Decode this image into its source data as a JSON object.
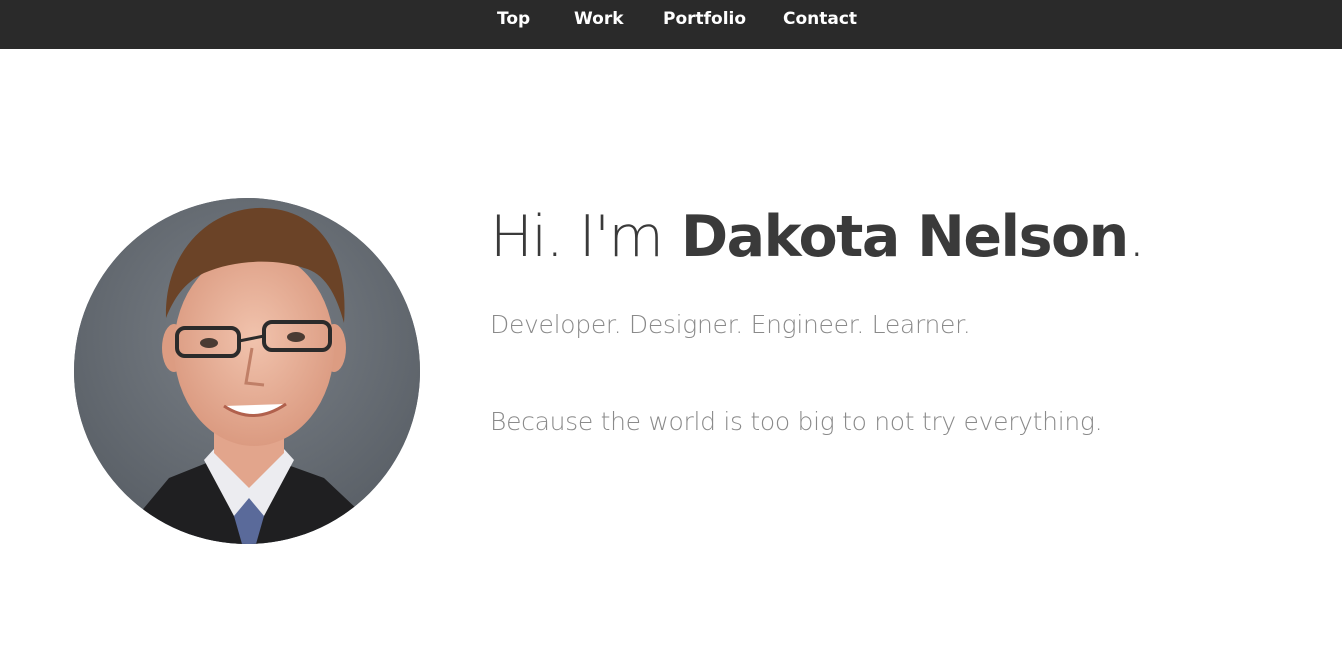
{
  "nav": {
    "items": [
      {
        "label": "Top"
      },
      {
        "label": "Work"
      },
      {
        "label": "Portfolio"
      },
      {
        "label": "Contact"
      }
    ]
  },
  "hero": {
    "greeting": "Hi. I'm",
    "name": "Dakota Nelson",
    "name_suffix": ".",
    "tagline": "Developer. Designer. Engineer. Learner.",
    "motto": "Because the world is too big to not try everything."
  },
  "colors": {
    "navbar_bg": "#2a2a2a",
    "nav_text": "#ffffff",
    "heading_text": "#3a3a3a",
    "subtext": "#8a8a8a",
    "page_bg": "#ffffff"
  }
}
